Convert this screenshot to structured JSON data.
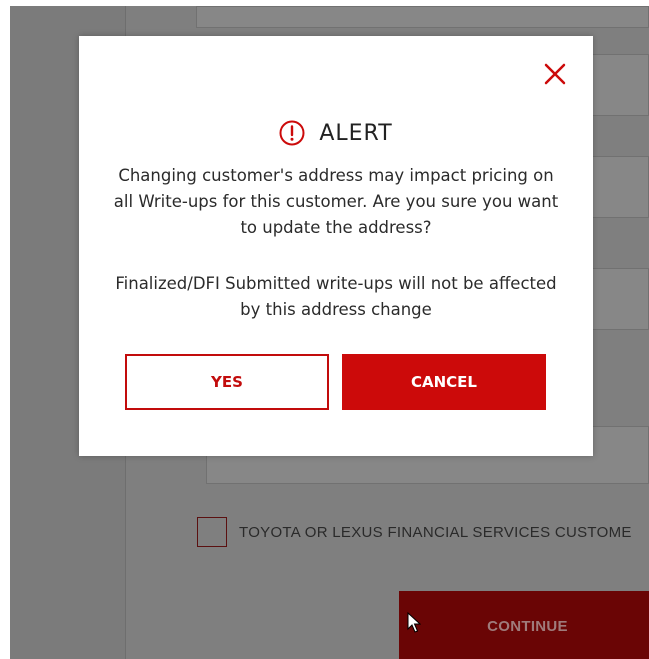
{
  "background": {
    "checkbox_label": "TOYOTA OR LEXUS FINANCIAL SERVICES CUSTOME",
    "continue_label": "CONTINUE"
  },
  "dialog": {
    "icon": "exclamation-circle-icon",
    "close_icon": "close-x-icon",
    "title": "ALERT",
    "message": "Changing customer's address may impact pricing on all Write-ups for this customer. Are you sure you want to update the address?",
    "note": "Finalized/DFI Submitted write-ups will not be affected by this address change",
    "yes_label": "YES",
    "cancel_label": "CANCEL"
  },
  "colors": {
    "accent": "#cc0a0a",
    "overlay": "#7f7f7f"
  }
}
